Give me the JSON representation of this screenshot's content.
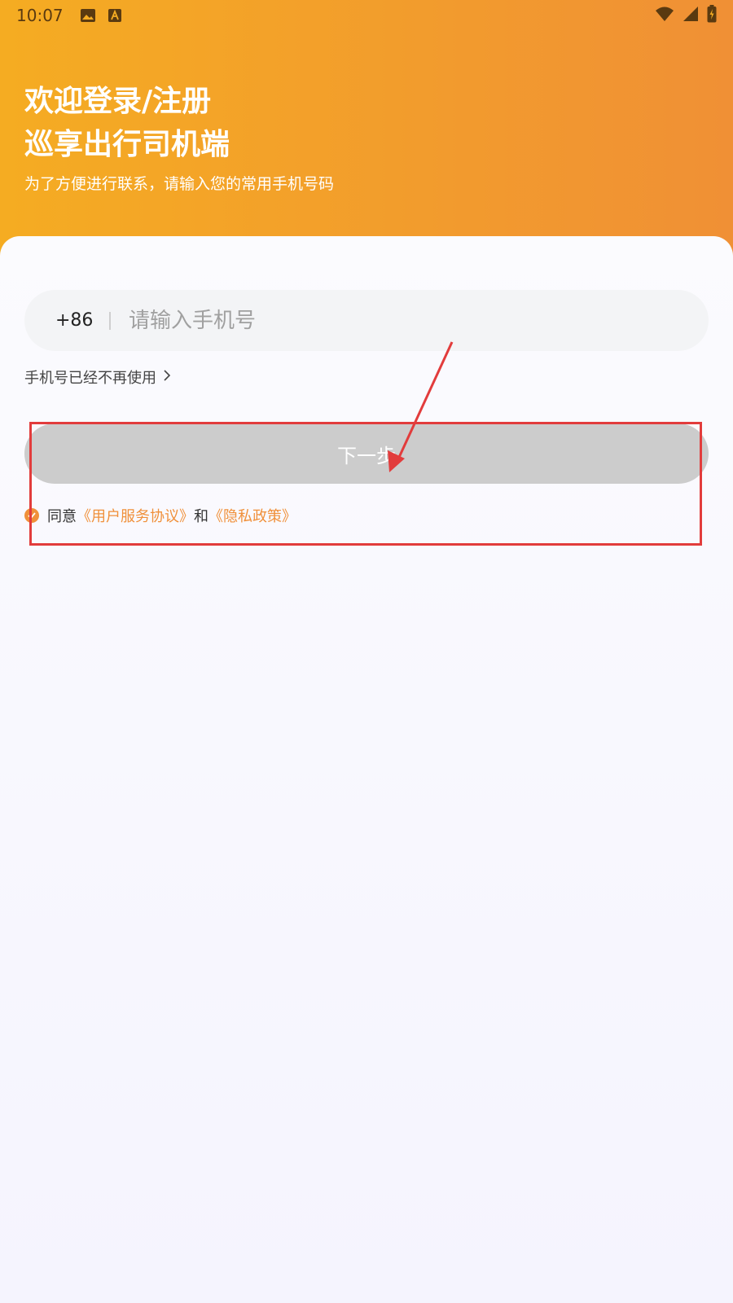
{
  "status_bar": {
    "time": "10:07",
    "icons": [
      "image-icon",
      "text-a-icon",
      "wifi-icon",
      "signal-icon",
      "battery-charging-icon"
    ]
  },
  "header": {
    "title_line1": "欢迎登录/注册",
    "title_line2": "巡享出行司机端",
    "subtitle": "为了方便进行联系，请输入您的常用手机号码"
  },
  "form": {
    "country_code": "+86",
    "phone_placeholder": "请输入手机号",
    "phone_value": "",
    "no_longer_label": "手机号已经不再使用",
    "next_button_label": "下一步",
    "agreement": {
      "prefix": "同意",
      "user_agreement": "《用户服务协议》",
      "connector": "和",
      "privacy_policy": "《隐私政策》",
      "checked": true
    }
  },
  "colors": {
    "header_gradient_start": "#f5ac22",
    "header_gradient_end": "#f09035",
    "accent": "#f0903a",
    "button_disabled": "#cccccc",
    "annotation": "#e23c3c"
  }
}
